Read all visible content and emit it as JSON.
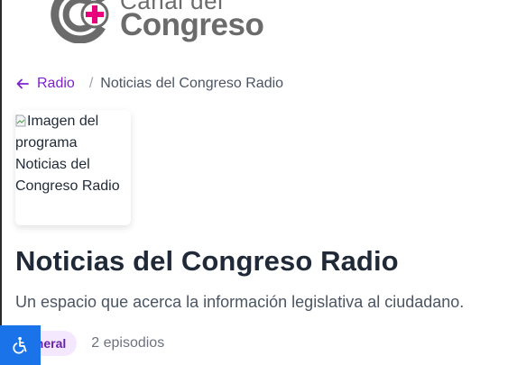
{
  "logo": {
    "top_text": "Canal del",
    "main_text": "Congreso"
  },
  "breadcrumb": {
    "back_label": "Radio",
    "separator": "/",
    "current": "Noticias del Congreso Radio"
  },
  "program": {
    "image_alt": "Imagen del programa Noticias del Congreso Radio",
    "title": "Noticias del Congreso Radio",
    "description": "Un espacio que acerca la información legislativa al ciudadano.",
    "tag_visible": "eneral",
    "episode_count": "2 episodios"
  },
  "colors": {
    "accent": "#7e22ce",
    "tag_bg": "#f3e8ff",
    "tag_text": "#6b21a8",
    "logo_gray": "#6b6b6b",
    "logo_plus": "#e6007e",
    "a11y_button": "#1a73e8"
  },
  "icons": {
    "back": "arrow-left-icon",
    "accessibility": "accessibility-icon",
    "broken_image": "broken-image-icon"
  }
}
